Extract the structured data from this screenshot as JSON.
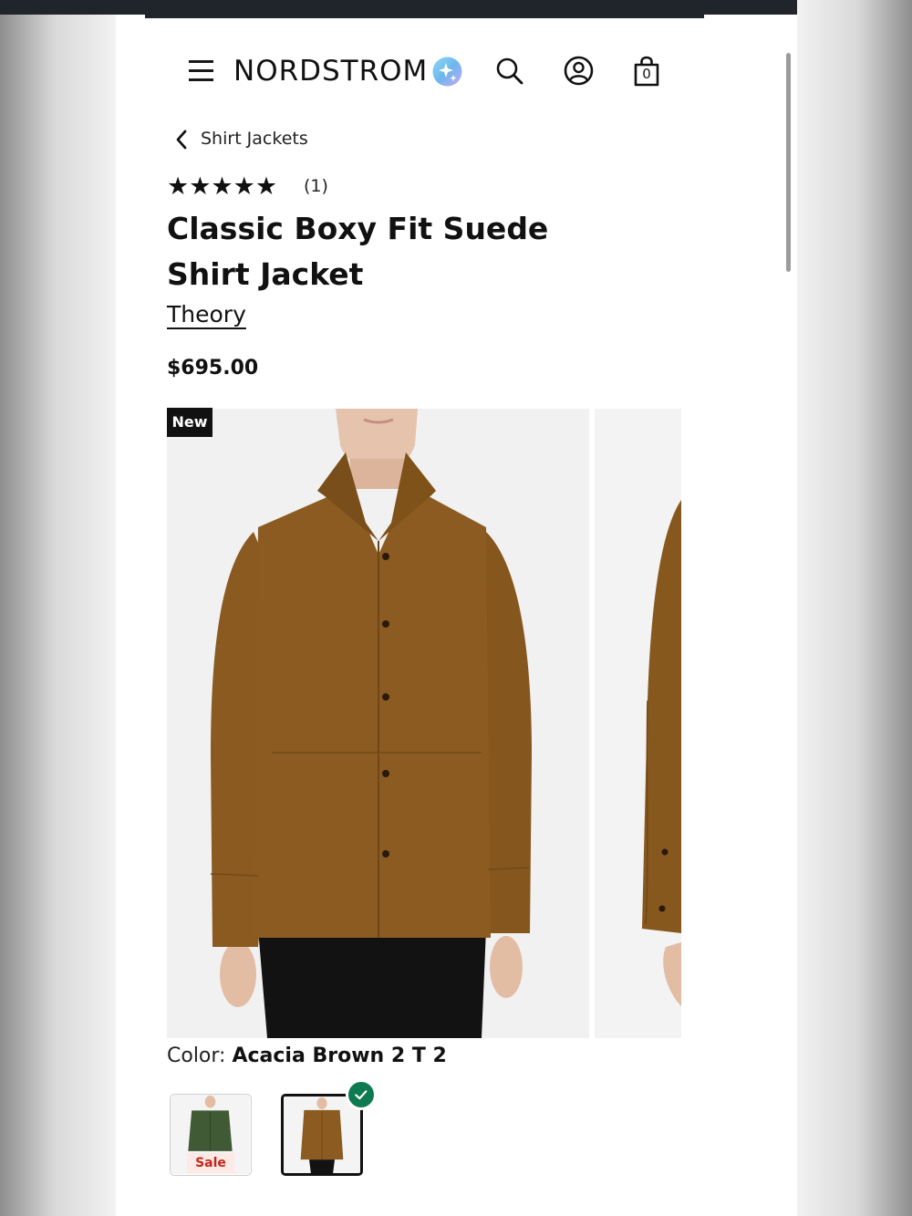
{
  "header": {
    "logo": "NORDSTROM",
    "bag_count": "0"
  },
  "breadcrumb": {
    "label": "Shirt Jackets"
  },
  "product": {
    "stars": "★★★★★",
    "rating_value": 5,
    "review_count": "(1)",
    "title": "Classic Boxy Fit Suede Shirt Jacket",
    "brand": "Theory",
    "price": "$695.00",
    "badge": "New",
    "color_label": "Color:",
    "color_value": "Acacia Brown 2 T 2"
  },
  "swatches": [
    {
      "name": "green",
      "tag": "Sale",
      "selected": false
    },
    {
      "name": "brown",
      "selected": true
    }
  ],
  "colors": {
    "jacket": "#8a5a20",
    "jacket_dark": "#6f4716",
    "swatch_green": "#3f5a35",
    "check": "#0e7a52",
    "sale_text": "#c0281b"
  },
  "icons": [
    "menu-icon",
    "ai-sparkle-icon",
    "search-icon",
    "account-icon",
    "shopping-bag-icon",
    "chevron-left-icon",
    "checkmark-icon"
  ]
}
